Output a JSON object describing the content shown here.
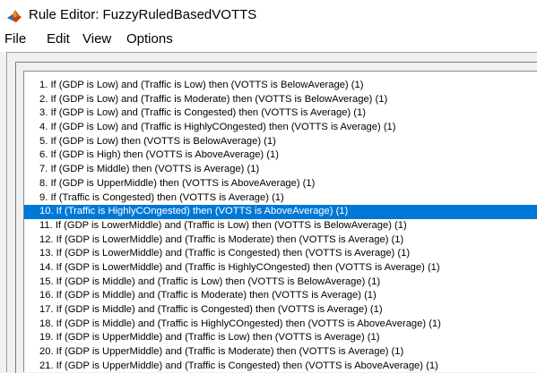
{
  "window": {
    "title": "Rule Editor: FuzzyRuledBasedVOTTS",
    "icon": "matlab-icon"
  },
  "menu": {
    "items": [
      "File",
      "Edit",
      "View",
      "Options"
    ]
  },
  "rules": {
    "selected_index": 9,
    "items": [
      "1. If (GDP is Low) and (Traffic is Low) then (VOTTS is BelowAverage) (1)",
      "2. If (GDP is Low) and (Traffic is Moderate) then (VOTTS is BelowAverage) (1)",
      "3. If (GDP is Low) and (Traffic is Congested) then (VOTTS is Average) (1)",
      "4. If (GDP is Low) and (Traffic is HighlyCOngested) then (VOTTS is Average) (1)",
      "5. If (GDP is Low) then (VOTTS is BelowAverage) (1)",
      "6. If (GDP is High) then (VOTTS is AboveAverage) (1)",
      "7. If (GDP is Middle) then (VOTTS is Average) (1)",
      "8. If (GDP is UpperMiddle) then (VOTTS is AboveAverage) (1)",
      "9. If (Traffic is Congested) then (VOTTS is Average) (1)",
      "10. If (Traffic is HighlyCOngested) then (VOTTS is AboveAverage) (1)",
      "11. If (GDP is LowerMiddle) and (Traffic is Low) then (VOTTS is BelowAverage) (1)",
      "12. If (GDP is LowerMiddle) and (Traffic is Moderate) then (VOTTS is Average) (1)",
      "13. If (GDP is LowerMiddle) and (Traffic is Congested) then (VOTTS is Average) (1)",
      "14. If (GDP is LowerMiddle) and (Traffic is HighlyCOngested) then (VOTTS is Average) (1)",
      "15. If (GDP is Middle) and (Traffic is Low) then (VOTTS is BelowAverage) (1)",
      "16. If (GDP is Middle) and (Traffic is Moderate) then (VOTTS is Average) (1)",
      "17. If (GDP is Middle) and (Traffic is Congested) then (VOTTS is Average) (1)",
      "18. If (GDP is Middle) and (Traffic is HighlyCOngested) then (VOTTS is AboveAverage) (1)",
      "19. If (GDP is UpperMiddle) and (Traffic is Low) then (VOTTS is Average) (1)",
      "20. If (GDP is UpperMiddle) and (Traffic is Moderate) then (VOTTS is Average) (1)",
      "21. If (GDP is UpperMiddle) and (Traffic is Congested) then (VOTTS is AboveAverage) (1)"
    ]
  },
  "colors": {
    "selection": "#0078d7",
    "selection_text": "#ffffff"
  }
}
